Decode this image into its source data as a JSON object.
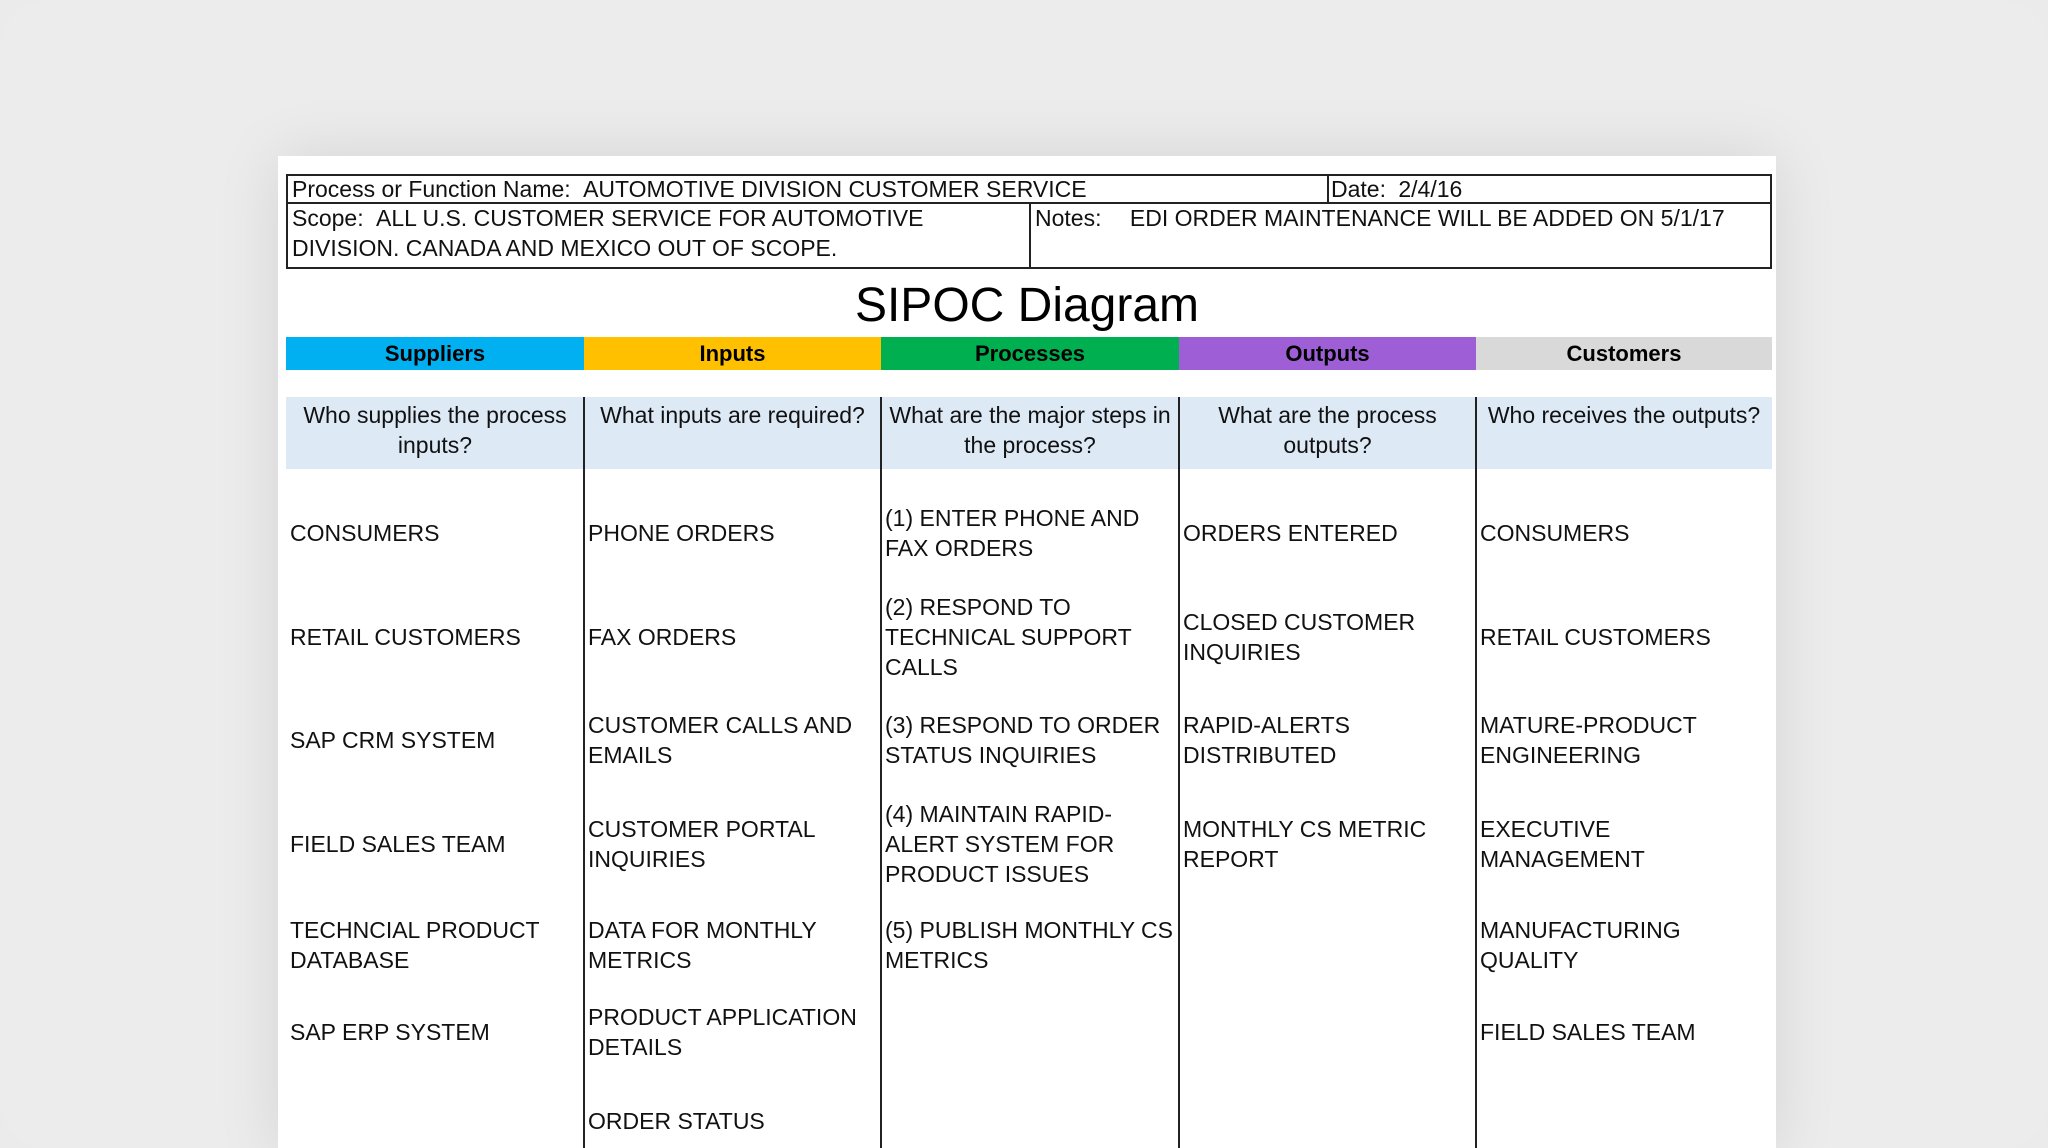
{
  "header": {
    "process_label": "Process or Function Name:",
    "process_value": "AUTOMOTIVE DIVISION CUSTOMER SERVICE",
    "date_label": "Date:",
    "date_value": "2/4/16",
    "scope_label": "Scope:",
    "scope_value": "ALL U.S. CUSTOMER SERVICE FOR AUTOMOTIVE DIVISION. CANADA AND MEXICO OUT OF SCOPE.",
    "notes_label": "Notes:",
    "notes_value": "EDI ORDER MAINTENANCE WILL BE ADDED ON 5/1/17"
  },
  "title": "SIPOC Diagram",
  "columns": [
    {
      "label": "Suppliers",
      "color": "#00b0f0",
      "question": "Who supplies the process inputs?",
      "items": [
        "CONSUMERS",
        "RETAIL CUSTOMERS",
        "SAP CRM SYSTEM",
        "FIELD SALES TEAM",
        "TECHNCIAL PRODUCT DATABASE",
        "SAP ERP SYSTEM"
      ]
    },
    {
      "label": "Inputs",
      "color": "#ffc000",
      "question": "What inputs are required?",
      "items": [
        "PHONE ORDERS",
        "FAX ORDERS",
        "CUSTOMER CALLS AND EMAILS",
        "CUSTOMER PORTAL INQUIRIES",
        "DATA FOR MONTHLY METRICS",
        "PRODUCT APPLICATION DETAILS",
        "ORDER STATUS"
      ]
    },
    {
      "label": "Processes",
      "color": "#00b050",
      "question": "What are the major steps in the process?",
      "items": [
        "(1) ENTER PHONE AND FAX ORDERS",
        "(2) RESPOND TO TECHNICAL SUPPORT CALLS",
        "(3) RESPOND TO ORDER STATUS INQUIRIES",
        "(4) MAINTAIN RAPID-ALERT SYSTEM FOR PRODUCT ISSUES",
        "(5) PUBLISH MONTHLY CS METRICS"
      ]
    },
    {
      "label": "Outputs",
      "color": "#9e5fd6",
      "question": "What are the process outputs?",
      "items": [
        "ORDERS ENTERED",
        "CLOSED CUSTOMER INQUIRIES",
        "RAPID-ALERTS DISTRIBUTED",
        "MONTHLY CS METRIC REPORT"
      ]
    },
    {
      "label": "Customers",
      "color": "#d9d9d9",
      "question": "Who receives the outputs?",
      "items": [
        "CONSUMERS",
        "RETAIL CUSTOMERS",
        "MATURE-PRODUCT ENGINEERING",
        "EXECUTIVE MANAGEMENT",
        "MANUFACTURING QUALITY",
        "FIELD SALES TEAM"
      ]
    }
  ]
}
